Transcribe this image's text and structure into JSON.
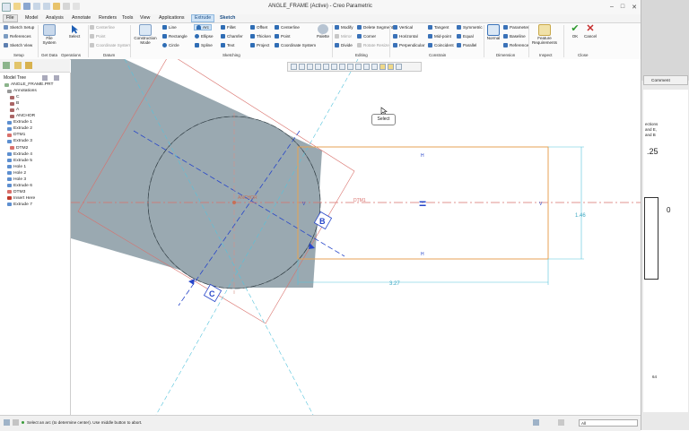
{
  "window": {
    "title": "ANGLE_FRAME (Active) - Creo Parametric",
    "controls": [
      "–",
      "□",
      "✕"
    ]
  },
  "tabs": [
    "File",
    "Model",
    "Analysis",
    "Annotate",
    "Renders",
    "Tools",
    "View",
    "Applications",
    "Extrude",
    "Sketch"
  ],
  "ribbon": {
    "setup": {
      "items": [
        "Sketch Setup",
        "References",
        "Sketch View"
      ],
      "label": "Setup"
    },
    "get_data": {
      "file_system": "File System",
      "label": "Get Data"
    },
    "operations": {
      "select": "Select",
      "label": "Operations"
    },
    "datum": {
      "items": [
        "Centerline",
        "Point",
        "Coordinate System"
      ],
      "label": "Datum"
    },
    "sketching": {
      "construction_mode": "Construction Mode",
      "col1": [
        "Line",
        "Rectangle",
        "Circle"
      ],
      "col2": [
        "Arc",
        "Ellipse",
        "Spline"
      ],
      "col3": [
        "Fillet",
        "Chamfer",
        "Text"
      ],
      "col4": [
        "Offset",
        "Thicken",
        "Project"
      ],
      "col5": [
        "Centerline",
        "Point",
        "Coordinate System"
      ],
      "palette": "Palette",
      "label": "Sketching"
    },
    "editing": {
      "items": [
        "Modify",
        "Delete Segment",
        "Mirror",
        "Corner",
        "Divide",
        "Rotate Resize"
      ],
      "label": "Editing"
    },
    "constrain": {
      "items": [
        "Vertical",
        "Tangent",
        "Symmetric",
        "Horizontal",
        "Mid-point",
        "Equal",
        "Perpendicular",
        "Coincident",
        "Parallel"
      ],
      "label": "Constrain"
    },
    "dimension": {
      "normal": "Normal",
      "items": [
        "Parameter",
        "Baseline",
        "Reference"
      ],
      "label": "Dimension"
    },
    "inspect": {
      "feature_requirements": "Feature Requirements",
      "label": "Inspect"
    },
    "close": {
      "ok": "OK",
      "cancel": "Cancel",
      "label": "Close"
    }
  },
  "model_tree": {
    "title": "Model Tree",
    "items": [
      "ANGLE_FRAME.PRT",
      "Annotations",
      "C",
      "B",
      "A",
      "ANCHOR",
      "Extrude 1",
      "Extrude 2",
      "DTM1",
      "Extrude 3",
      "DTM2",
      "Extrude 4",
      "Extrude 5",
      "Hole 1",
      "Hole 2",
      "Hole 3",
      "Extrude 6",
      "DTM3",
      "Insert Here",
      "Extrude 7"
    ]
  },
  "canvas": {
    "tooltip": "Select",
    "labels": {
      "anchor": "ANCHOR",
      "dtm": "DTM1",
      "b": "B",
      "c": "C",
      "h_top": "H",
      "h_bottom": "H",
      "v_left": "V",
      "v_right": "V",
      "dim_vertical": "1.46",
      "dim_horizontal": "3.27",
      "equal": "="
    }
  },
  "status": {
    "message": "Select an arc (to determine center). Use middle button to abort.",
    "filter": "All"
  },
  "right_panel": {
    "comment": "Comment",
    "lines": [
      "ections",
      "and E,",
      "and B"
    ],
    "page_fragment": ".25",
    "page_fragment2": "0",
    "page_number": "64"
  },
  "colors": {
    "part_fill": "#9aa9b1",
    "sketch_orange": "#e7a254",
    "dim_cyan": "#55c3dc",
    "datum_red": "#d9706b",
    "axis_blue": "#2746c9"
  }
}
